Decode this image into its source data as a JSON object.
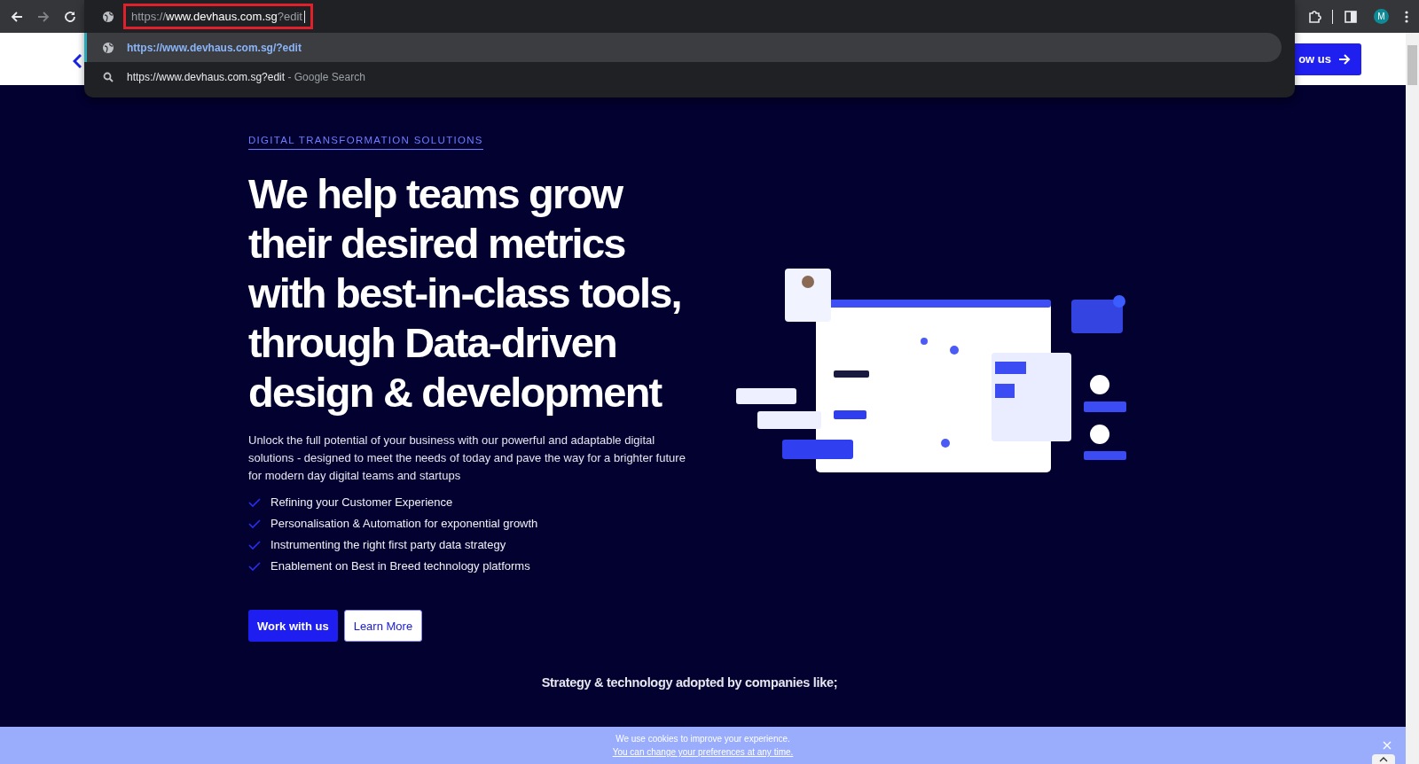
{
  "browser": {
    "nav_buttons": [
      {
        "kind": "back",
        "disabled": false
      },
      {
        "kind": "forward",
        "disabled": true
      },
      {
        "kind": "reload",
        "disabled": false
      }
    ],
    "address": {
      "scheme": "https://",
      "host": "www.devhaus.com.sg",
      "rest": "?edit",
      "highlighted": true
    },
    "suggestions": [
      {
        "kind": "url",
        "text": "https://www.devhaus.com.sg/?edit",
        "selected": true
      },
      {
        "kind": "search",
        "text": "https://www.devhaus.com.sg?edit",
        "suffix": "- Google Search",
        "selected": false
      }
    ],
    "profile": "M"
  },
  "header": {
    "cta": "ow us"
  },
  "hero": {
    "eyebrow": "DIGITAL TRANSFORMATION SOLUTIONS",
    "heading": [
      "We help teams grow",
      "their desired metrics",
      "with best-in-class tools,",
      "through Data-driven",
      "design & development"
    ],
    "intro": "Unlock the full potential of your business with our powerful and adaptable digital solutions - designed to meet the needs of today and pave the way for a brighter future for modern day digital teams and startups",
    "features": [
      "Refining your Customer Experience",
      "Personalisation & Automation for exponential growth",
      "Instrumenting the right first party data strategy",
      "Enablement on Best in Breed technology platforms"
    ],
    "buttons": [
      {
        "kind": "primary",
        "label": "Work with us"
      },
      {
        "kind": "secondary",
        "label": "Learn More"
      }
    ],
    "illustration": {
      "kind": "picture"
    },
    "clients_title": "Strategy & technology adopted by companies like;"
  },
  "cookie_bar": {
    "message": "We use cookies to improve your experience.",
    "link": "You can change your preferences at any time."
  }
}
